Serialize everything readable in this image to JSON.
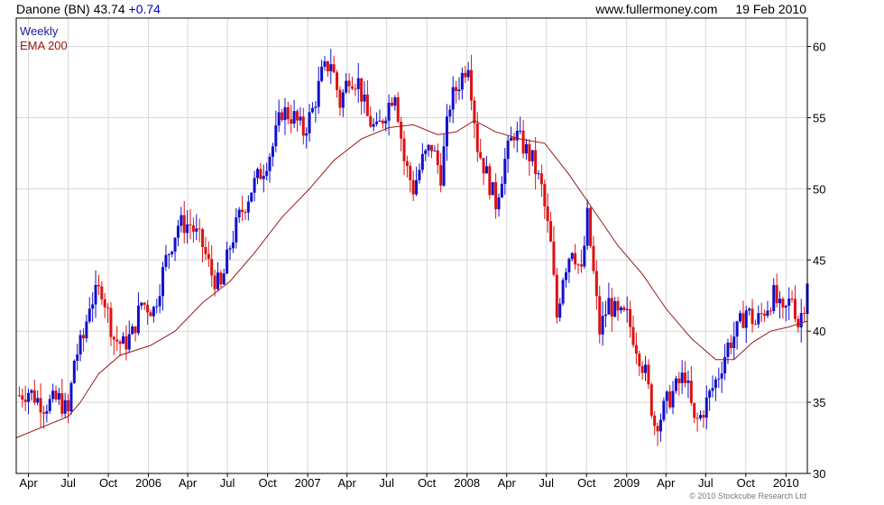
{
  "header": {
    "ticker": "Danone (BN) 43.74",
    "change": "+0.74",
    "site": "www.fullermoney.com",
    "date": "19 Feb 2010"
  },
  "footer": {
    "copyright": "© 2010 Stockcube Research Ltd"
  },
  "colors": {
    "up": "#1010cc",
    "down": "#dd1111",
    "ema": "#9a1a1a",
    "grid": "#d8d8d8"
  },
  "chart_data": {
    "type": "line",
    "title": "",
    "xlabel": "",
    "ylabel": "",
    "ylim": [
      30,
      62
    ],
    "y_ticks": [
      30,
      35,
      40,
      45,
      50,
      55,
      60
    ],
    "x_ticks": [
      "Apr",
      "Jul",
      "Oct",
      "2006",
      "Apr",
      "Jul",
      "Oct",
      "2007",
      "Apr",
      "Jul",
      "Oct",
      "2008",
      "Apr",
      "Jul",
      "Oct",
      "2009",
      "Apr",
      "Jul",
      "Oct",
      "2010"
    ],
    "x_range": [
      "2005-03-04",
      "2010-02-19"
    ],
    "grid": true,
    "legend_position": "top-left",
    "series": [
      {
        "name": "Weekly",
        "kind": "price",
        "points": [
          [
            "2005-03-11",
            35.5
          ],
          [
            "2005-04-01",
            35.8
          ],
          [
            "2005-05-06",
            34.8
          ],
          [
            "2005-06-10",
            35.2
          ],
          [
            "2005-07-01",
            34.2
          ],
          [
            "2005-07-15",
            38
          ],
          [
            "2005-08-05",
            39.5
          ],
          [
            "2005-08-19",
            42
          ],
          [
            "2005-09-16",
            43
          ],
          [
            "2005-10-14",
            39.5
          ],
          [
            "2005-11-04",
            39
          ],
          [
            "2005-11-25",
            39.8
          ],
          [
            "2005-12-16",
            42
          ],
          [
            "2006-01-13",
            41.5
          ],
          [
            "2006-02-10",
            45
          ],
          [
            "2006-03-10",
            47.5
          ],
          [
            "2006-04-07",
            47.5
          ],
          [
            "2006-05-05",
            46
          ],
          [
            "2006-05-26",
            44
          ],
          [
            "2006-06-16",
            43
          ],
          [
            "2006-07-07",
            46
          ],
          [
            "2006-07-28",
            48
          ],
          [
            "2006-08-25",
            50
          ],
          [
            "2006-09-22",
            51.5
          ],
          [
            "2006-10-13",
            53
          ],
          [
            "2006-11-03",
            55.5
          ],
          [
            "2006-12-01",
            55
          ],
          [
            "2006-12-22",
            54
          ],
          [
            "2007-01-12",
            55.5
          ],
          [
            "2007-02-02",
            58
          ],
          [
            "2007-02-23",
            59
          ],
          [
            "2007-03-16",
            56
          ],
          [
            "2007-04-06",
            58
          ],
          [
            "2007-04-27",
            57.5
          ],
          [
            "2007-05-18",
            55
          ],
          [
            "2007-06-08",
            54
          ],
          [
            "2007-06-29",
            55.5
          ],
          [
            "2007-07-20",
            57
          ],
          [
            "2007-08-10",
            52
          ],
          [
            "2007-08-31",
            50
          ],
          [
            "2007-09-21",
            52
          ],
          [
            "2007-10-12",
            53
          ],
          [
            "2007-11-02",
            51
          ],
          [
            "2007-11-23",
            56
          ],
          [
            "2007-12-14",
            57.5
          ],
          [
            "2008-01-04",
            59
          ],
          [
            "2008-01-25",
            53
          ],
          [
            "2008-02-15",
            51
          ],
          [
            "2008-03-07",
            49
          ],
          [
            "2008-03-28",
            52
          ],
          [
            "2008-04-18",
            54
          ],
          [
            "2008-05-09",
            53
          ],
          [
            "2008-05-30",
            52
          ],
          [
            "2008-06-20",
            50
          ],
          [
            "2008-07-11",
            46
          ],
          [
            "2008-07-25",
            41
          ],
          [
            "2008-08-08",
            44
          ],
          [
            "2008-08-29",
            46
          ],
          [
            "2008-09-19",
            44
          ],
          [
            "2008-10-03",
            48
          ],
          [
            "2008-10-17",
            44
          ],
          [
            "2008-10-31",
            40
          ],
          [
            "2008-11-21",
            42
          ],
          [
            "2008-12-12",
            41
          ],
          [
            "2009-01-02",
            41
          ],
          [
            "2009-01-23",
            39
          ],
          [
            "2009-02-13",
            37
          ],
          [
            "2009-03-06",
            33.5
          ],
          [
            "2009-03-20",
            34
          ],
          [
            "2009-04-03",
            35
          ],
          [
            "2009-04-24",
            36
          ],
          [
            "2009-05-15",
            37
          ],
          [
            "2009-06-05",
            33.5
          ],
          [
            "2009-06-19",
            34
          ],
          [
            "2009-07-10",
            35.5
          ],
          [
            "2009-07-31",
            37
          ],
          [
            "2009-08-21",
            39
          ],
          [
            "2009-09-11",
            40
          ],
          [
            "2009-10-02",
            41.5
          ],
          [
            "2009-10-23",
            40.5
          ],
          [
            "2009-11-13",
            41.5
          ],
          [
            "2009-12-04",
            42.5
          ],
          [
            "2009-12-25",
            41
          ],
          [
            "2010-01-15",
            42.5
          ],
          [
            "2010-01-29",
            40.5
          ],
          [
            "2010-02-12",
            42
          ],
          [
            "2010-02-19",
            43.74
          ]
        ]
      },
      {
        "name": "EMA 200",
        "kind": "line",
        "points": [
          [
            "2005-03-04",
            32.5
          ],
          [
            "2005-05-06",
            33.3
          ],
          [
            "2005-07-01",
            34.0
          ],
          [
            "2005-07-29",
            35.0
          ],
          [
            "2005-09-09",
            37.0
          ],
          [
            "2005-10-28",
            38.3
          ],
          [
            "2006-01-06",
            39.0
          ],
          [
            "2006-03-03",
            40.0
          ],
          [
            "2006-05-05",
            42.0
          ],
          [
            "2006-07-07",
            43.5
          ],
          [
            "2006-09-01",
            45.5
          ],
          [
            "2006-11-03",
            48.0
          ],
          [
            "2007-01-05",
            50.0
          ],
          [
            "2007-03-02",
            52.0
          ],
          [
            "2007-05-04",
            53.5
          ],
          [
            "2007-07-06",
            54.3
          ],
          [
            "2007-08-31",
            54.5
          ],
          [
            "2007-10-26",
            53.8
          ],
          [
            "2007-12-07",
            54.0
          ],
          [
            "2008-01-18",
            54.8
          ],
          [
            "2008-03-07",
            54.0
          ],
          [
            "2008-05-02",
            53.5
          ],
          [
            "2008-06-27",
            53.2
          ],
          [
            "2008-08-22",
            51.0
          ],
          [
            "2008-10-17",
            48.5
          ],
          [
            "2008-12-12",
            46.0
          ],
          [
            "2009-02-06",
            44.0
          ],
          [
            "2009-04-03",
            41.5
          ],
          [
            "2009-05-29",
            39.5
          ],
          [
            "2009-07-24",
            38.0
          ],
          [
            "2009-09-04",
            38.0
          ],
          [
            "2009-10-16",
            39.2
          ],
          [
            "2009-11-27",
            40.0
          ],
          [
            "2010-01-08",
            40.3
          ],
          [
            "2010-02-19",
            40.7
          ]
        ]
      }
    ]
  }
}
